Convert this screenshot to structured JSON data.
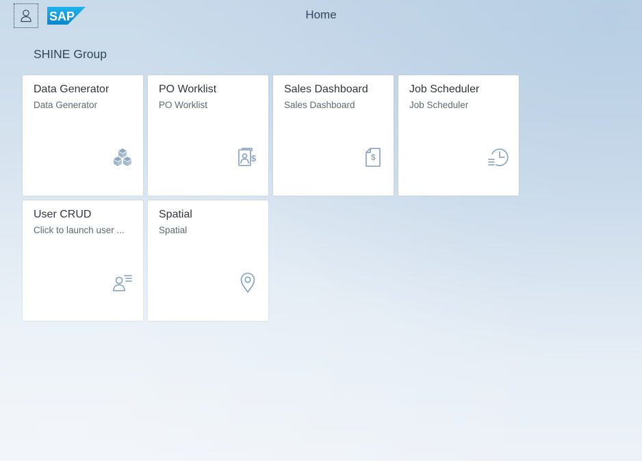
{
  "header": {
    "title": "Home",
    "logo_text": "SAP",
    "user_icon": "user-icon"
  },
  "group": {
    "title": "SHINE Group"
  },
  "tiles": [
    {
      "title": "Data Generator",
      "subtitle": "Data Generator",
      "icon": "cube-icon"
    },
    {
      "title": "PO Worklist",
      "subtitle": "PO Worklist",
      "icon": "customer-financial-icon"
    },
    {
      "title": "Sales Dashboard",
      "subtitle": "Sales Dashboard",
      "icon": "sales-document-icon"
    },
    {
      "title": "Job Scheduler",
      "subtitle": "Job Scheduler",
      "icon": "history-clock-icon"
    },
    {
      "title": "User CRUD",
      "subtitle": "Click to launch user ...",
      "icon": "user-list-icon"
    },
    {
      "title": "Spatial",
      "subtitle": "Spatial",
      "icon": "map-pin-icon"
    }
  ],
  "colors": {
    "icon": "#8ea9c4",
    "logo_blue": "#1aa0e0",
    "text_dark": "#32363a",
    "text_light": "#5e696e"
  }
}
